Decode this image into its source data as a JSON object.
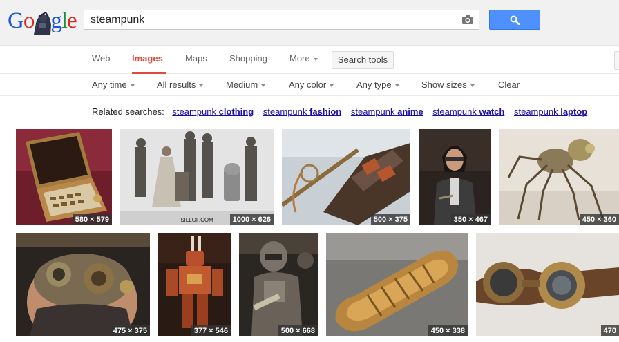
{
  "logo": {
    "letters": [
      "G",
      "o",
      "g",
      "l",
      "e"
    ],
    "colors": [
      "#1a56d6",
      "#d62d20",
      "#1a56d6",
      "#1a8d3a",
      "#d62d20"
    ]
  },
  "search": {
    "query": "steampunk",
    "button_icon": "magnifier-icon",
    "camera_icon": "camera-icon"
  },
  "tabs": [
    {
      "label": "Web",
      "active": false
    },
    {
      "label": "Images",
      "active": true
    },
    {
      "label": "Maps",
      "active": false
    },
    {
      "label": "Shopping",
      "active": false
    },
    {
      "label": "More",
      "active": false
    }
  ],
  "search_tools_label": "Search tools",
  "filters": [
    {
      "label": "Any time"
    },
    {
      "label": "All results"
    },
    {
      "label": "Medium"
    },
    {
      "label": "Any color"
    },
    {
      "label": "Any type"
    },
    {
      "label": "Show sizes"
    },
    {
      "label": "Clear"
    }
  ],
  "related": {
    "label": "Related searches:",
    "items": [
      {
        "prefix": "steampunk",
        "bold": "clothing"
      },
      {
        "prefix": "steampunk",
        "bold": "fashion"
      },
      {
        "prefix": "steampunk",
        "bold": "anime"
      },
      {
        "prefix": "steampunk",
        "bold": "watch"
      },
      {
        "prefix": "steampunk",
        "bold": "laptop"
      }
    ]
  },
  "images": [
    {
      "size": "580 × 579",
      "subject": "laptop"
    },
    {
      "size": "1000 × 626",
      "subject": "figures",
      "watermark": "SILLOF.COM"
    },
    {
      "size": "500 × 375",
      "subject": "guitar"
    },
    {
      "size": "350 × 467",
      "subject": "man"
    },
    {
      "size": "450 × 360",
      "subject": "spider"
    },
    {
      "size": "475 × 375",
      "subject": "mask"
    },
    {
      "size": "377 × 546",
      "subject": "robot"
    },
    {
      "size": "500 × 668",
      "subject": "armor"
    },
    {
      "size": "450 × 338",
      "subject": "shoe"
    },
    {
      "size": "470",
      "subject": "goggles"
    }
  ]
}
